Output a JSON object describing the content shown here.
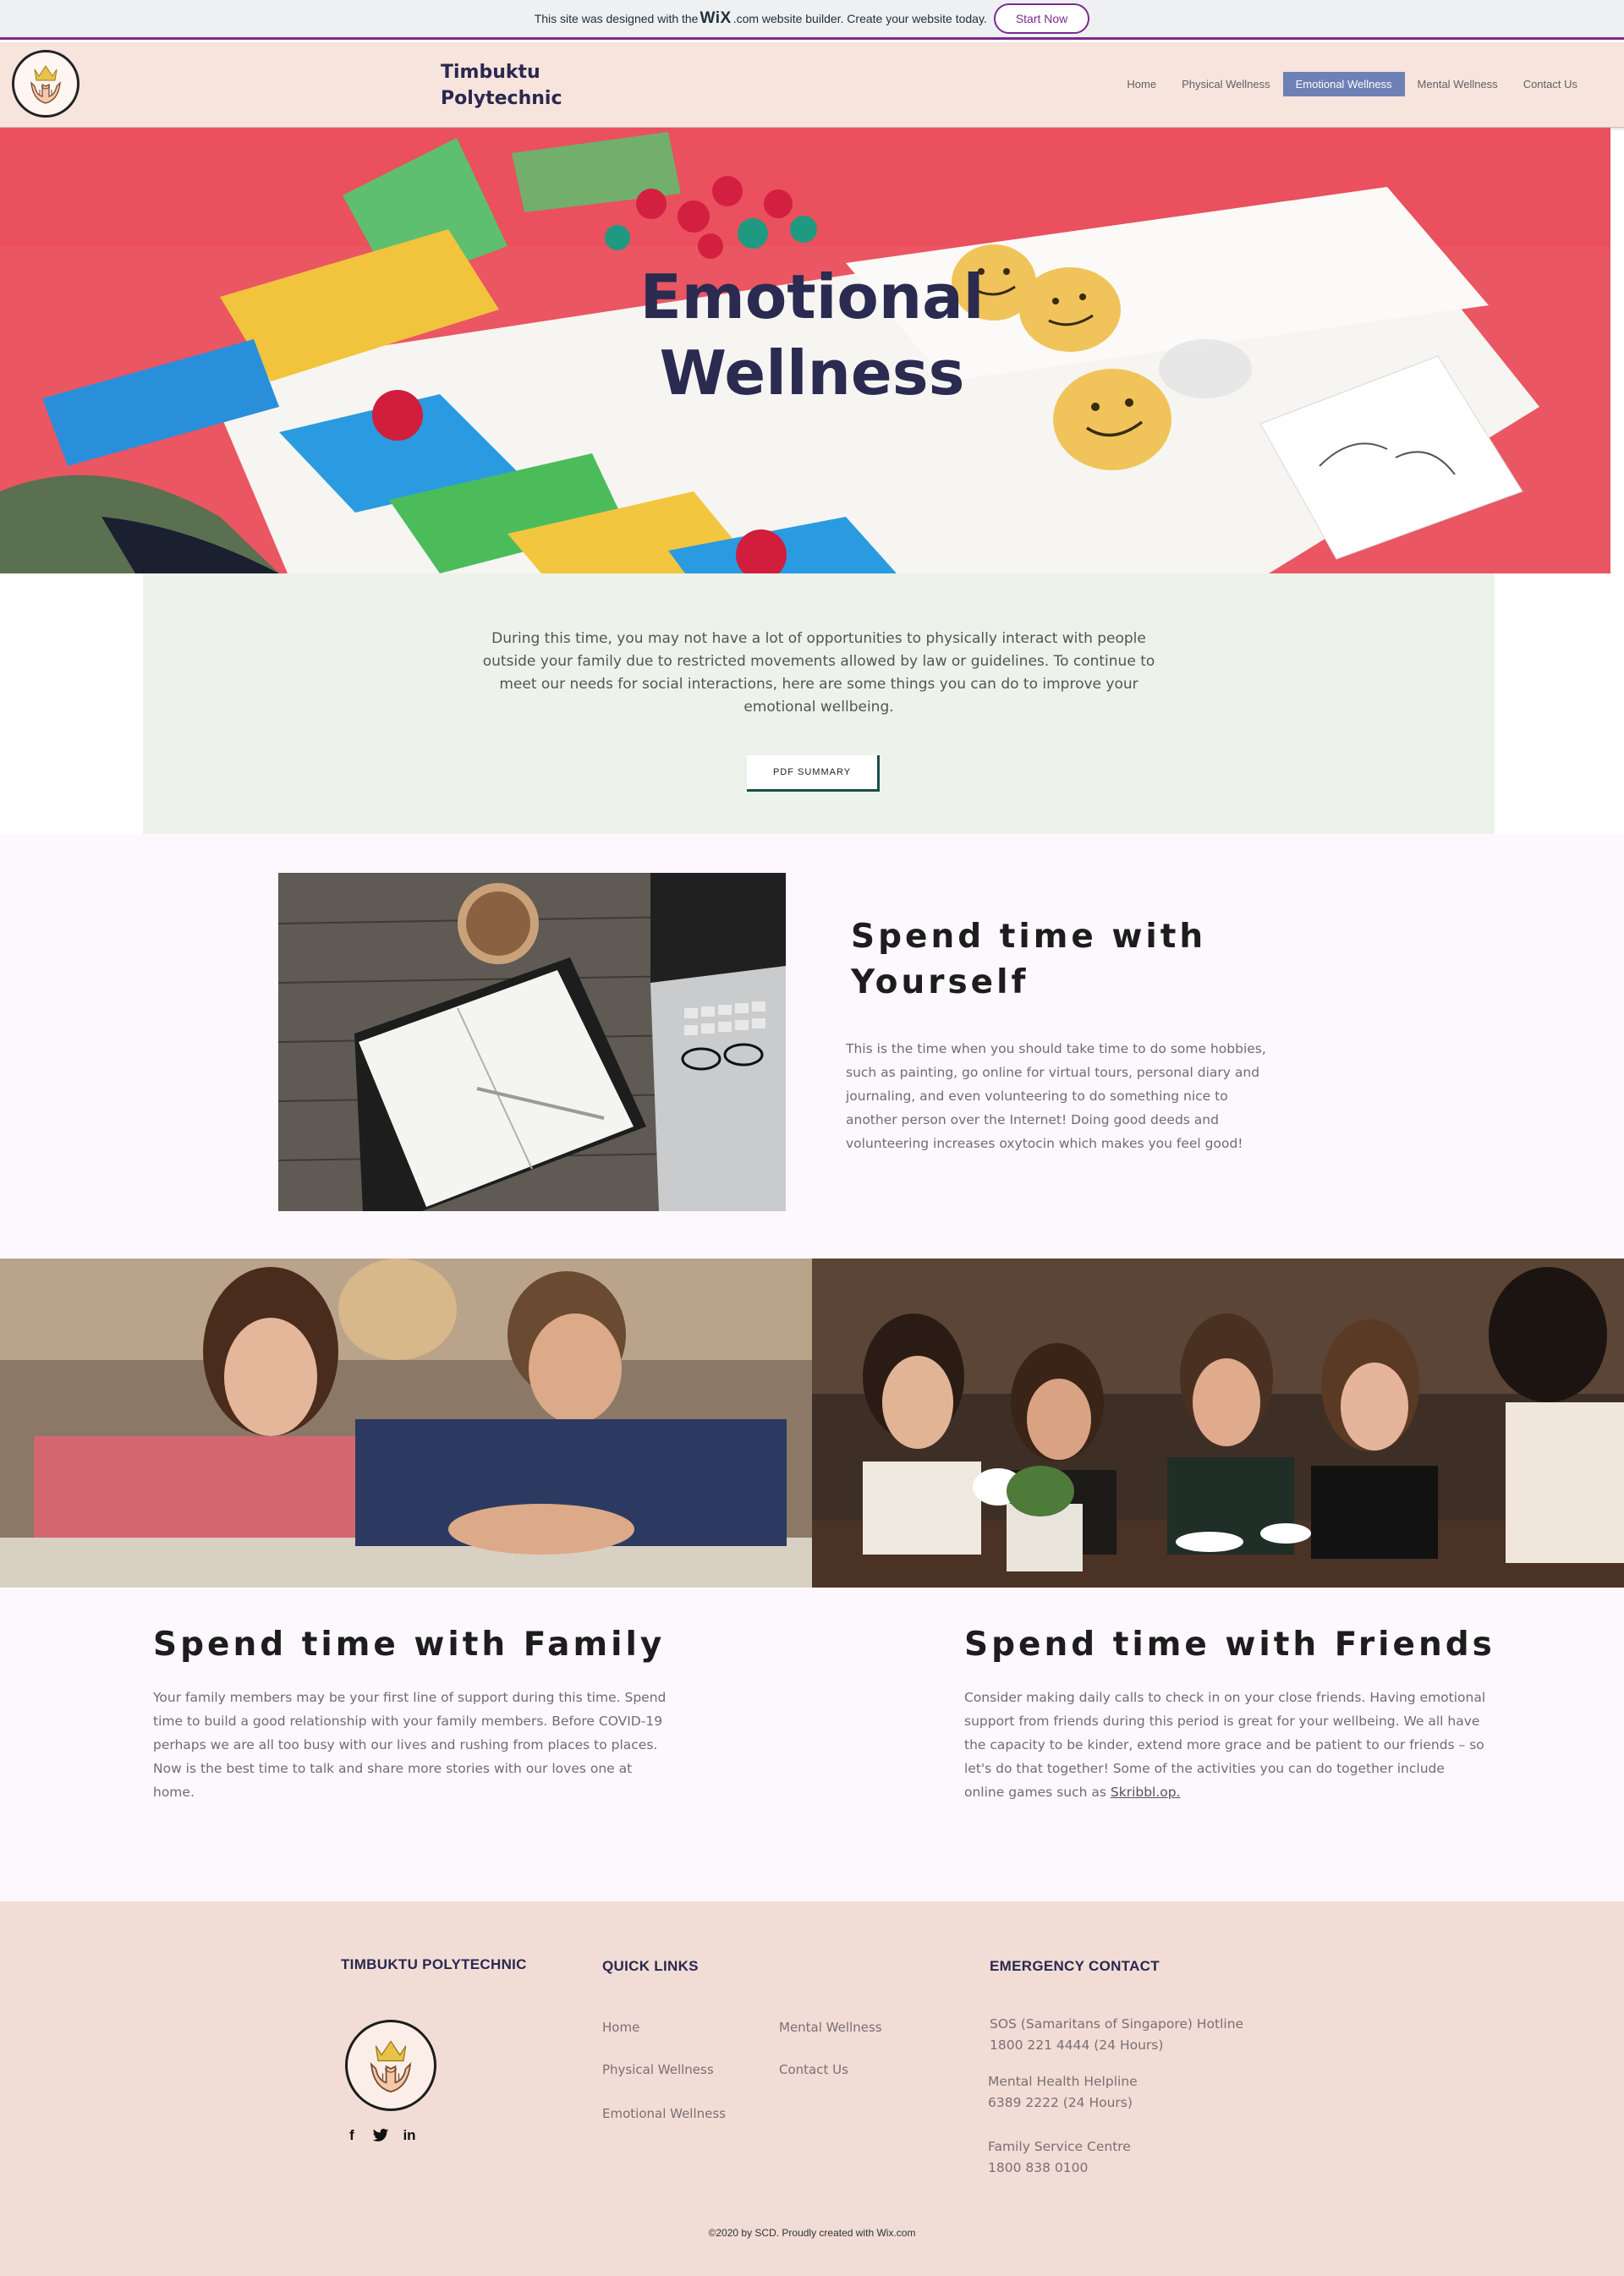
{
  "wix_banner": {
    "text_before": "This site was designed with the",
    "logo": "WiX",
    "text_after": ".com website builder. Create your website today.",
    "button": "Start Now"
  },
  "header": {
    "brand_line1": "Timbuktu",
    "brand_line2": "Polytechnic",
    "logo_icon": "crown-hands-logo-icon",
    "nav": [
      {
        "label": "Home",
        "active": false
      },
      {
        "label": "Physical Wellness",
        "active": false
      },
      {
        "label": "Emotional Wellness",
        "active": true
      },
      {
        "label": "Mental Wellness",
        "active": false
      },
      {
        "label": "Contact Us",
        "active": false
      }
    ]
  },
  "hero": {
    "title_line1": "Emotional",
    "title_line2": "Wellness"
  },
  "intro": {
    "text": "During this time, you may not have a lot of opportunities to physically interact with people outside your family due to restricted movements allowed by law or guidelines. To continue to meet our needs for social interactions, here are some things you can do to improve your emotional wellbeing.",
    "button": "PDF SUMMARY"
  },
  "yourself": {
    "heading_line1": "Spend time with",
    "heading_line2": "Yourself",
    "text": "This is the time when you should take time to do some hobbies, such as painting, go online for virtual tours, personal diary and journaling, and even volunteering to do something nice to another person over the Internet! Doing good deeds and volunteering increases oxytocin which makes you feel good!"
  },
  "family": {
    "heading": "Spend time with Family",
    "text": "Your family members may be your first line of support during this time. Spend time to build a good relationship with your family members. Before COVID-19 perhaps we are all too busy with our lives and rushing from places to places. Now is the best time to talk and share more stories with our loves one at home."
  },
  "friends": {
    "heading": "Spend time with Friends",
    "text": "Consider making daily calls to check in on your close friends. Having emotional support from friends during this period is great for your wellbeing. We all have the capacity to be kinder, extend more grace and be patient to our friends – so let's do that together! Some of the activities you can do together include online games such as",
    "link": "Skribbl.op."
  },
  "footer": {
    "col1_heading": "TIMBUKTU POLYTECHNIC",
    "col2_heading": "QUICK LINKS",
    "col3_heading": "EMERGENCY CONTACT",
    "links": [
      "Home",
      "Physical Wellness",
      "Emotional Wellness",
      "Mental Wellness",
      "Contact Us"
    ],
    "social": [
      "f",
      "t",
      "in"
    ],
    "contacts": [
      {
        "name": "SOS (Samaritans of Singapore) Hotline",
        "number": "1800 221 4444 (24 Hours)"
      },
      {
        "name": "Mental Health Helpline",
        "number": "6389 2222 (24 Hours)"
      },
      {
        "name": "Family Service Centre",
        "number": "1800 838 0100"
      }
    ],
    "copyright": "©2020 by SCD. Proudly created with Wix.com"
  },
  "colors": {
    "accent_purple": "#7b2a8f",
    "nav_active": "#6e80b5",
    "brand_navy": "#2a2850",
    "header_bg": "#f6e4dd",
    "intro_bg": "#edf2ea",
    "footer_bg": "#f1ddd6"
  }
}
